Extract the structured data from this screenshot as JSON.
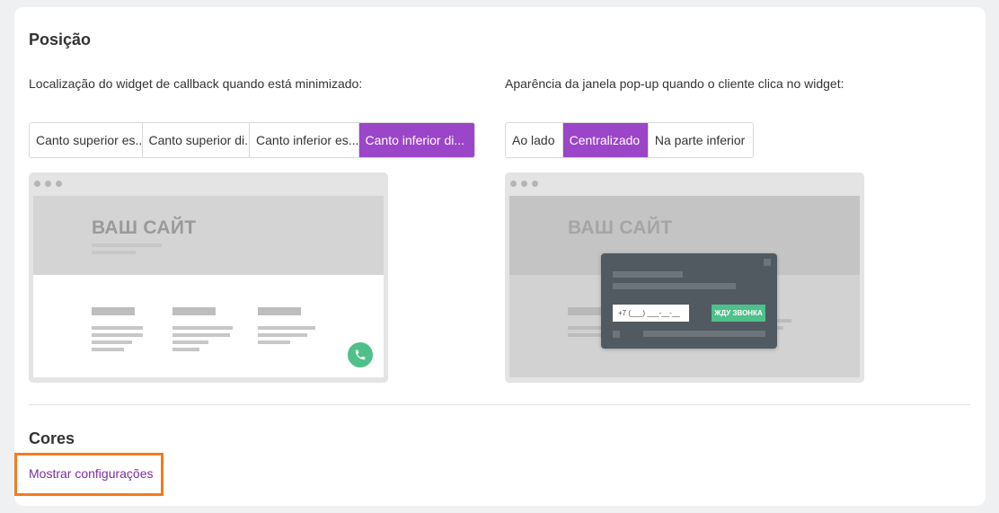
{
  "position_section": {
    "title": "Posição",
    "minimized_location_label": "Localização do widget de callback quando está minimizado:",
    "popup_appearance_label": "Aparência da janela pop-up quando o cliente clica no widget:",
    "location_options": [
      {
        "label": "Canto superior es..",
        "active": false
      },
      {
        "label": "Canto superior di..",
        "active": false
      },
      {
        "label": "Canto inferior es...",
        "active": false
      },
      {
        "label": "Canto inferior di...",
        "active": true
      }
    ],
    "popup_options": [
      {
        "label": "Ao lado",
        "active": false
      },
      {
        "label": "Centralizado",
        "active": true
      },
      {
        "label": "Na parte inferior",
        "active": false
      }
    ]
  },
  "preview_left": {
    "site_title": "ВАШ САЙТ",
    "icon": "phone-icon"
  },
  "preview_right": {
    "site_title": "ВАШ САЙТ",
    "phone_placeholder": "+7 (___) ___-__-__",
    "button_label": "ЖДУ ЗВОНКА"
  },
  "colors_section": {
    "title": "Cores",
    "show_settings_link": "Mostrar configurações"
  },
  "colors": {
    "accent": "#9b45c8",
    "link": "#7b2e9e",
    "widget_green": "#4ec08a",
    "highlight": "#f07c1e"
  }
}
